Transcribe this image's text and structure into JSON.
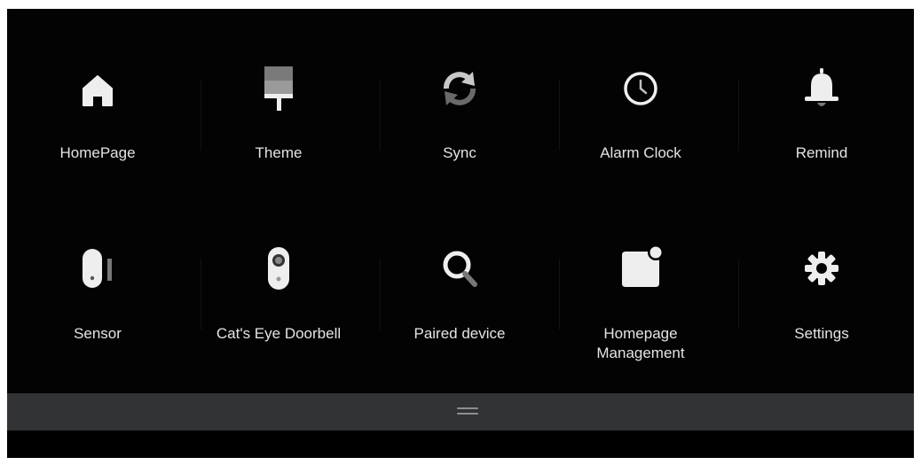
{
  "menu": {
    "items": [
      {
        "label": "HomePage",
        "icon": "home-icon"
      },
      {
        "label": "Theme",
        "icon": "paint-roller-icon"
      },
      {
        "label": "Sync",
        "icon": "sync-icon"
      },
      {
        "label": "Alarm Clock",
        "icon": "clock-icon"
      },
      {
        "label": "Remind",
        "icon": "bell-icon"
      },
      {
        "label": "Sensor",
        "icon": "sensor-icon"
      },
      {
        "label": "Cat's Eye Doorbell",
        "icon": "doorbell-icon"
      },
      {
        "label": "Paired device",
        "icon": "search-icon"
      },
      {
        "label": "Homepage\nManagement",
        "icon": "card-badge-icon"
      },
      {
        "label": "Settings",
        "icon": "gear-icon"
      }
    ]
  },
  "bottom_bar": {
    "icon": "drag-handle-icon"
  },
  "colors": {
    "background": "#030303",
    "icon": "#eeeeee",
    "label": "#e4e4e4",
    "bar": "#313335"
  }
}
